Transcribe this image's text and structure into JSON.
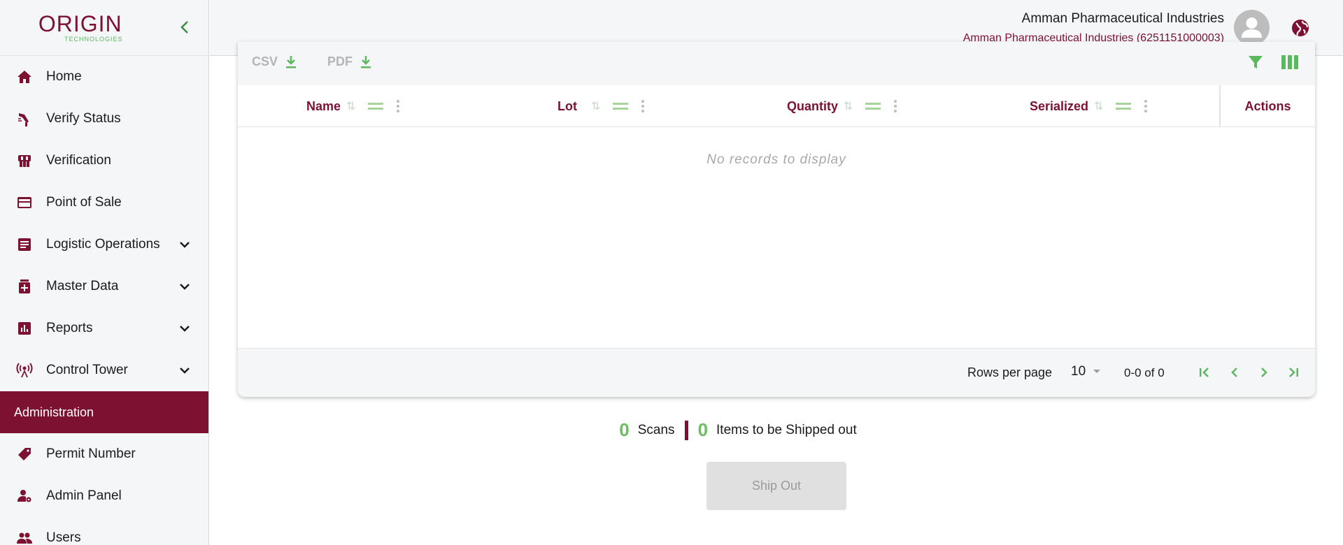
{
  "app": {
    "logo_text": "ORIGIN",
    "logo_sub": "TECHNOLOGIES"
  },
  "sidebar": {
    "items": [
      {
        "label": "Home",
        "icon": "home-icon"
      },
      {
        "label": "Verify Status",
        "icon": "scanner-icon"
      },
      {
        "label": "Verification",
        "icon": "verification-icon"
      },
      {
        "label": "Point of Sale",
        "icon": "credit-card-icon"
      },
      {
        "label": "Logistic Operations",
        "icon": "list-document-icon",
        "expandable": true
      },
      {
        "label": "Master Data",
        "icon": "medical-box-icon",
        "expandable": true
      },
      {
        "label": "Reports",
        "icon": "bar-chart-icon",
        "expandable": true
      },
      {
        "label": "Control Tower",
        "icon": "tower-icon",
        "expandable": true
      }
    ],
    "section_label": "Administration",
    "admin_items": [
      {
        "label": "Permit Number",
        "icon": "tag-icon"
      },
      {
        "label": "Admin Panel",
        "icon": "user-gear-icon"
      },
      {
        "label": "Users",
        "icon": "users-icon"
      }
    ]
  },
  "header": {
    "org_name": "Amman Pharmaceutical Industries",
    "org_detail": "Amman Pharmaceutical Industries (6251151000003)"
  },
  "table": {
    "export_csv": "CSV",
    "export_pdf": "PDF",
    "columns": [
      "Name",
      "Lot",
      "Quantity",
      "Serialized"
    ],
    "actions_header": "Actions",
    "empty_message": "No records to display",
    "rows": []
  },
  "pagination": {
    "rows_per_page_label": "Rows per page",
    "rows_per_page": "10",
    "range": "0-0 of 0"
  },
  "summary": {
    "scans_count": "0",
    "scans_label": "Scans",
    "items_count": "0",
    "items_label": "Items to be Shipped out"
  },
  "actions": {
    "ship_out": "Ship Out"
  },
  "colors": {
    "brand": "#7d1131",
    "accent_green": "#6bbf5f",
    "sidebar_bg": "#f4f6f8"
  }
}
